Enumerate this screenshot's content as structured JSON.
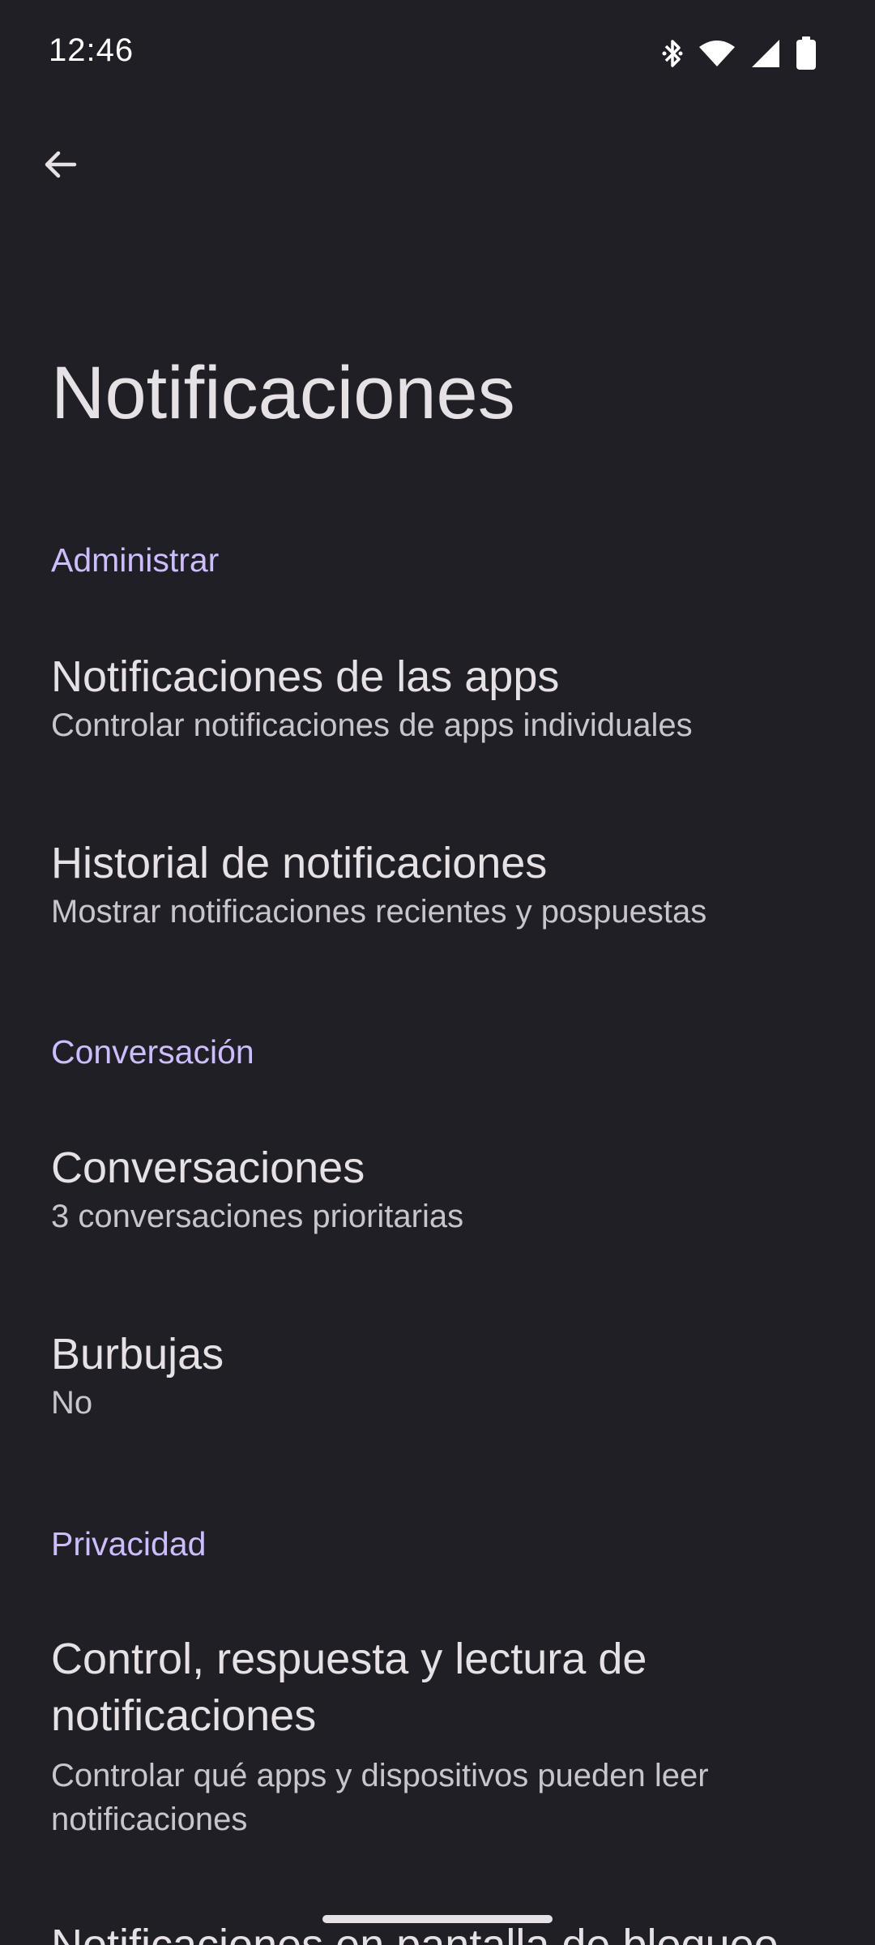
{
  "status_bar": {
    "time": "12:46",
    "icons": [
      "bluetooth-icon",
      "wifi-icon",
      "signal-icon",
      "battery-icon"
    ]
  },
  "header": {
    "back_icon": "arrow-back-icon",
    "title": "Notificaciones"
  },
  "sections": [
    {
      "header": "Administrar",
      "items": [
        {
          "title": "Notificaciones de las apps",
          "subtitle": "Controlar notificaciones de apps individuales"
        },
        {
          "title": "Historial de notificaciones",
          "subtitle": "Mostrar notificaciones recientes y pospuestas"
        }
      ]
    },
    {
      "header": "Conversación",
      "items": [
        {
          "title": "Conversaciones",
          "subtitle": "3 conversaciones prioritarias"
        },
        {
          "title": "Burbujas",
          "subtitle": "No"
        }
      ]
    },
    {
      "header": "Privacidad",
      "items": [
        {
          "title": "Control, respuesta y lectura de notificaciones",
          "subtitle": "Controlar qué apps y dispositivos pueden leer notificaciones"
        },
        {
          "title": "Notificaciones en pantalla de bloqueo",
          "subtitle": ""
        }
      ]
    }
  ],
  "colors": {
    "background": "#211f26",
    "text_primary": "#e6e1e5",
    "text_secondary": "#c9c5cc",
    "accent": "#cdbdff"
  }
}
